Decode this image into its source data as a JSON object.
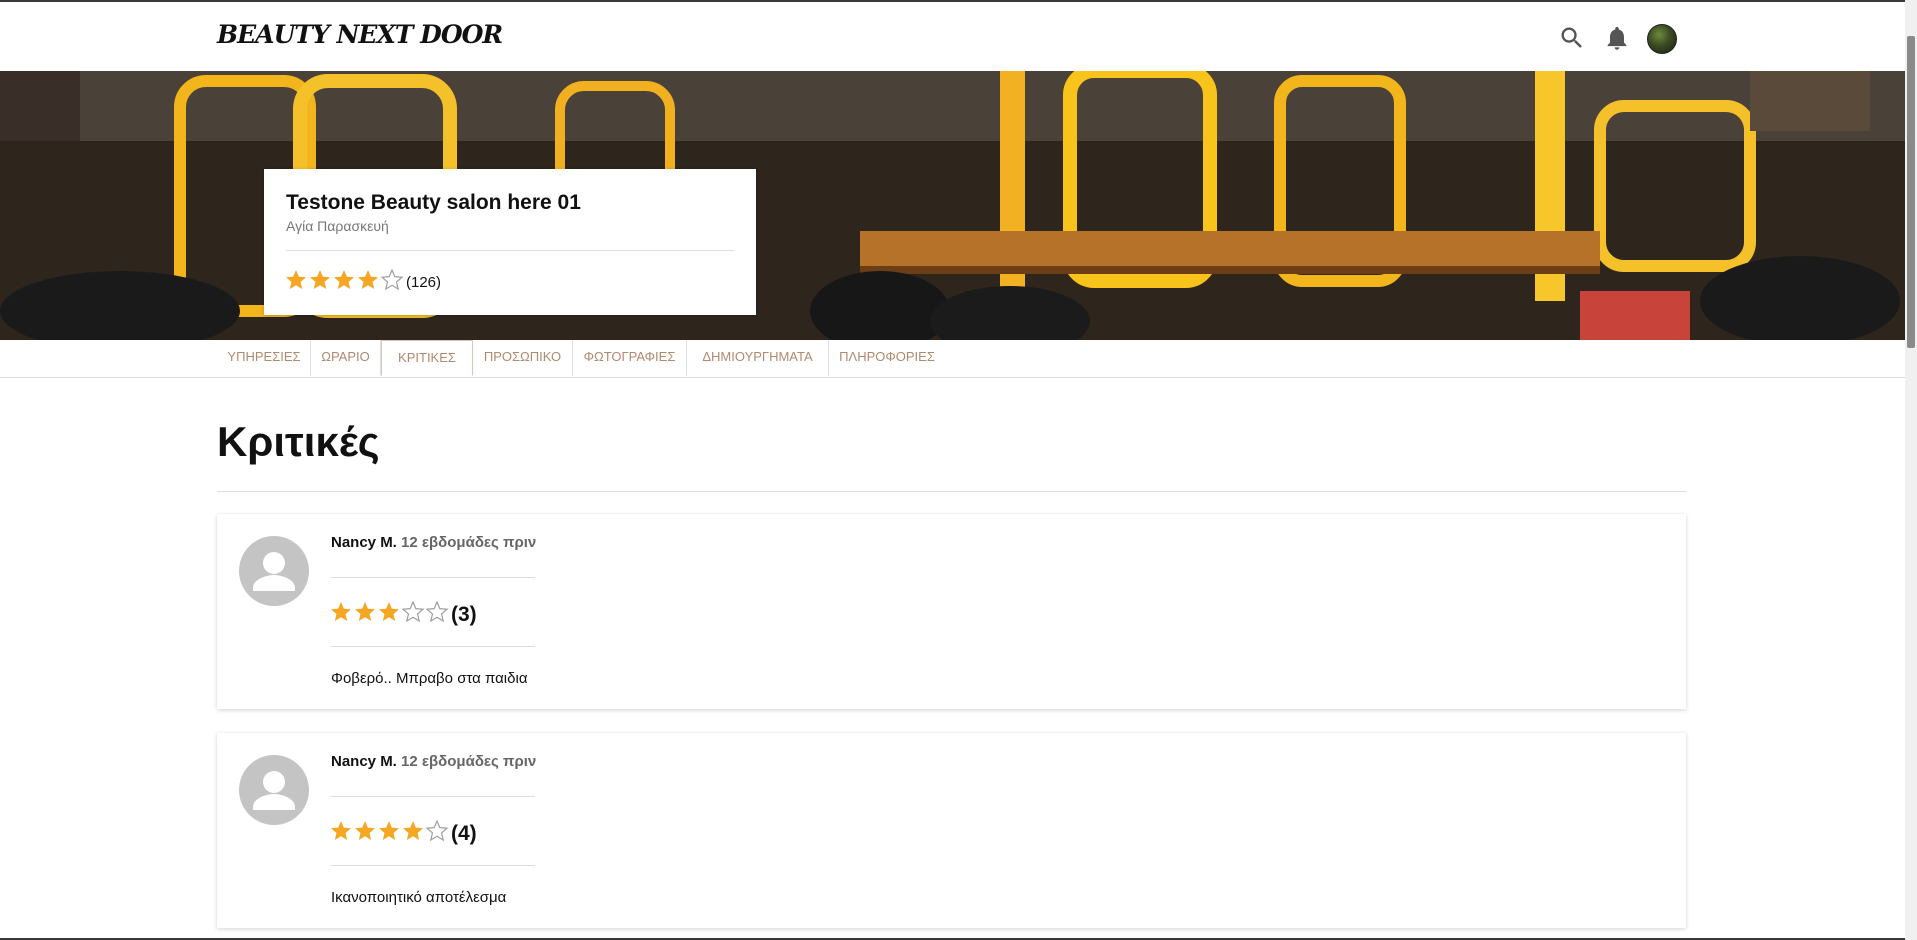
{
  "header": {
    "logo": "BEAUTY NEXT DOOR",
    "icons": [
      "search-icon",
      "bell-icon",
      "user-avatar"
    ]
  },
  "salon": {
    "name": "Testone Beauty salon here 01",
    "location": "Αγία Παρασκευή",
    "rating": 4,
    "max_rating": 5,
    "review_count": "(126)"
  },
  "tabs": [
    {
      "label": "ΥΠΗΡΕΣΙΕΣ",
      "active": false
    },
    {
      "label": "ΩΡΑΡΙΟ",
      "active": false
    },
    {
      "label": "ΚΡΙΤΙΚΕΣ",
      "active": true
    },
    {
      "label": "ΠΡΟΣΩΠΙΚΟ",
      "active": false
    },
    {
      "label": "ΦΩΤΟΓΡΑΦΙΕΣ",
      "active": false
    },
    {
      "label": "ΔΗΜΙΟΥΡΓΗΜΑΤΑ",
      "active": false
    },
    {
      "label": "ΠΛΗΡΟΦΟΡΙΕΣ",
      "active": false
    }
  ],
  "page_title": "Κριτικές",
  "reviews": [
    {
      "name": "Nancy M.",
      "time": "12 εβδομάδες πριν",
      "rating": 3,
      "rating_label": "(3)",
      "text": "Φοβερό.. Μπραβο στα παιδια"
    },
    {
      "name": "Nancy M.",
      "time": "12 εβδομάδες πριν",
      "rating": 4,
      "rating_label": "(4)",
      "text": "Ικανοποιητικό αποτέλεσμα"
    }
  ],
  "colors": {
    "star_filled": "#f5a623",
    "star_empty": "#9e9e9e",
    "tab_text": "#b08a6e",
    "avatar_bg": "#c4c4c4"
  }
}
